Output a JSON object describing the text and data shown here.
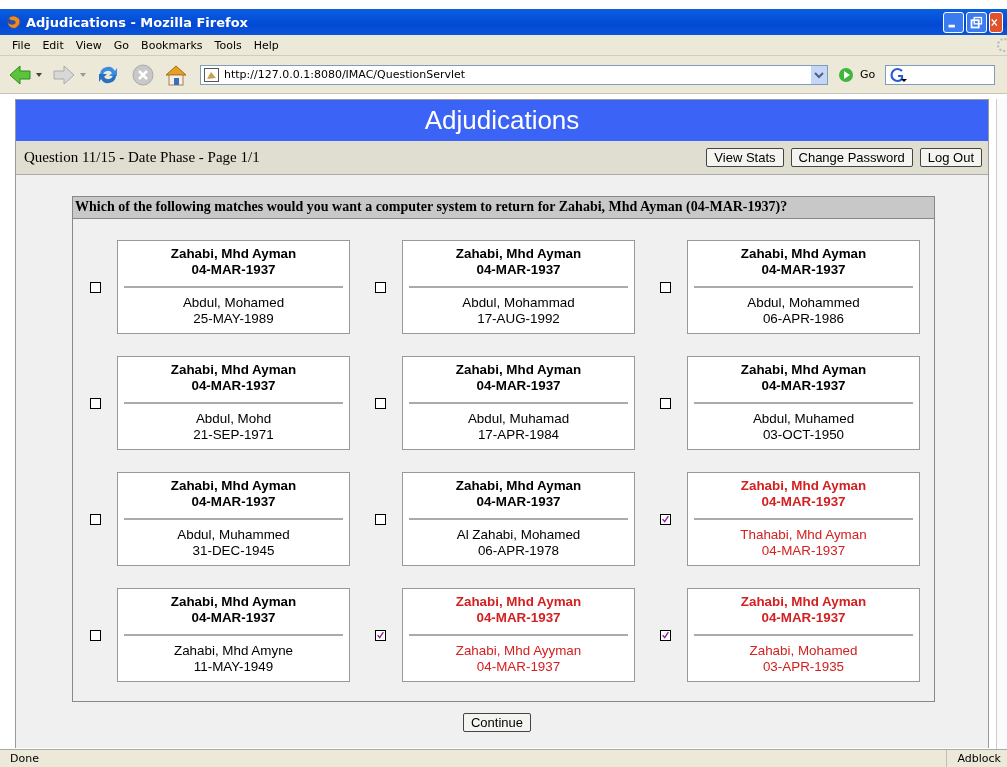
{
  "window": {
    "title": "Adjudications - Mozilla Firefox"
  },
  "menu": [
    "File",
    "Edit",
    "View",
    "Go",
    "Bookmarks",
    "Tools",
    "Help"
  ],
  "address": {
    "value": "http://127.0.0.1:8080/IMAC/QuestionServlet",
    "go_label": "Go"
  },
  "page": {
    "heading": "Adjudications",
    "progress": "Question 11/15 - Date Phase - Page 1/1",
    "buttons": [
      "View Stats",
      "Change Password",
      "Log Out"
    ],
    "question": "Which of the following matches would you want a computer system to return for Zahabi, Mhd Ayman (04-MAR-1937)?",
    "matches": [
      {
        "query_name": "Zahabi, Mhd Ayman",
        "query_date": "04-MAR-1937",
        "candidate_name": "Abdul, Mohamed",
        "candidate_date": "25-MAY-1989",
        "checked": false
      },
      {
        "query_name": "Zahabi, Mhd Ayman",
        "query_date": "04-MAR-1937",
        "candidate_name": "Abdul, Mohammad",
        "candidate_date": "17-AUG-1992",
        "checked": false
      },
      {
        "query_name": "Zahabi, Mhd Ayman",
        "query_date": "04-MAR-1937",
        "candidate_name": "Abdul, Mohammed",
        "candidate_date": "06-APR-1986",
        "checked": false
      },
      {
        "query_name": "Zahabi, Mhd Ayman",
        "query_date": "04-MAR-1937",
        "candidate_name": "Abdul, Mohd",
        "candidate_date": "21-SEP-1971",
        "checked": false
      },
      {
        "query_name": "Zahabi, Mhd Ayman",
        "query_date": "04-MAR-1937",
        "candidate_name": "Abdul, Muhamad",
        "candidate_date": "17-APR-1984",
        "checked": false
      },
      {
        "query_name": "Zahabi, Mhd Ayman",
        "query_date": "04-MAR-1937",
        "candidate_name": "Abdul, Muhamed",
        "candidate_date": "03-OCT-1950",
        "checked": false
      },
      {
        "query_name": "Zahabi, Mhd Ayman",
        "query_date": "04-MAR-1937",
        "candidate_name": "Abdul, Muhammed",
        "candidate_date": "31-DEC-1945",
        "checked": false
      },
      {
        "query_name": "Zahabi, Mhd Ayman",
        "query_date": "04-MAR-1937",
        "candidate_name": "Al Zahabi, Mohamed",
        "candidate_date": "06-APR-1978",
        "checked": false
      },
      {
        "query_name": "Zahabi, Mhd Ayman",
        "query_date": "04-MAR-1937",
        "candidate_name": "Thahabi, Mhd Ayman",
        "candidate_date": "04-MAR-1937",
        "checked": true
      },
      {
        "query_name": "Zahabi, Mhd Ayman",
        "query_date": "04-MAR-1937",
        "candidate_name": "Zahabi, Mhd Amyne",
        "candidate_date": "11-MAY-1949",
        "checked": false
      },
      {
        "query_name": "Zahabi, Mhd Ayman",
        "query_date": "04-MAR-1937",
        "candidate_name": "Zahabi, Mhd Ayyman",
        "candidate_date": "04-MAR-1937",
        "checked": true
      },
      {
        "query_name": "Zahabi, Mhd Ayman",
        "query_date": "04-MAR-1937",
        "candidate_name": "Zahabi, Mohamed",
        "candidate_date": "03-APR-1935",
        "checked": true
      }
    ],
    "continue": "Continue"
  },
  "status_bar": {
    "text": "Done",
    "addon": "Adblock"
  }
}
